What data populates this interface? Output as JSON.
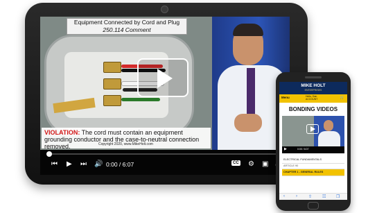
{
  "tablet": {
    "video": {
      "caption_line1": "Equipment Connected by Cord and Plug",
      "caption_line2": "250.114 Comment",
      "violation_label": "VIOLATION:",
      "violation_text": " The cord must contain an equipment grounding conductor and the case-to-neutral connection removed.",
      "copyright": "Copyright 2020, www.MikeHolt.com"
    },
    "player": {
      "current_time": "0:00",
      "separator": " / ",
      "duration": "6:07",
      "progress_fraction": 0.0,
      "cc_label": "CC",
      "icons": {
        "skip_back": "skip-back-icon",
        "play": "play-icon",
        "skip_forward": "skip-forward-icon",
        "volume": "volume-icon",
        "captions": "cc-icon",
        "settings": "gear-icon",
        "picture_in_picture": "pip-icon",
        "fullscreen": "fullscreen-icon"
      }
    }
  },
  "phone": {
    "logo_line1": "MIKE HOLT",
    "logo_line2": "ENTERPRISES",
    "menu_label": "Menu",
    "hello_line1": "Hello, Dan",
    "hello_line2": "ACCOUNT",
    "page_title": "BONDING VIDEOS",
    "video_time": "0:00 / 6:07",
    "list": [
      {
        "label": "ELECTRICAL FUNDAMENTALS"
      },
      {
        "label": "ARTICLE 90"
      },
      {
        "label": "CHAPTER 1 - GENERAL RULES"
      }
    ]
  },
  "colors": {
    "violation_red": "#d21414",
    "brand_navy": "#0d2a5c",
    "brand_yellow": "#f2c200"
  }
}
